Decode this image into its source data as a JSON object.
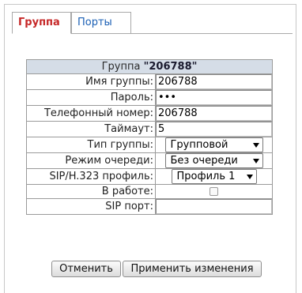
{
  "tabs": [
    {
      "label": "Группа",
      "active": true
    },
    {
      "label": "Порты",
      "active": false
    }
  ],
  "form": {
    "header_label": "Группа",
    "header_value": "\"206788\"",
    "fields": {
      "group_name": {
        "label": "Имя группы:",
        "value": "206788"
      },
      "password": {
        "label": "Пароль:",
        "value": "•••"
      },
      "phone": {
        "label": "Телефонный номер:",
        "value": "206788"
      },
      "timeout": {
        "label": "Таймаут:",
        "value": "5"
      },
      "group_type": {
        "label": "Тип группы:",
        "value": "Групповой"
      },
      "queue_mode": {
        "label": "Режим очереди:",
        "value": "Без очереди"
      },
      "sip_profile": {
        "label": "SIP/H.323 профиль:",
        "value": "Профиль 1"
      },
      "in_service": {
        "label": "В работе:",
        "checked": false
      },
      "sip_port": {
        "label": "SIP порт:",
        "value": ""
      }
    }
  },
  "buttons": {
    "cancel": "Отменить",
    "apply": "Применить изменения"
  },
  "colors": {
    "active_tab_text": "#c62828",
    "inactive_tab_text": "#1a5fb4",
    "header_bg": "#d5dde7"
  }
}
